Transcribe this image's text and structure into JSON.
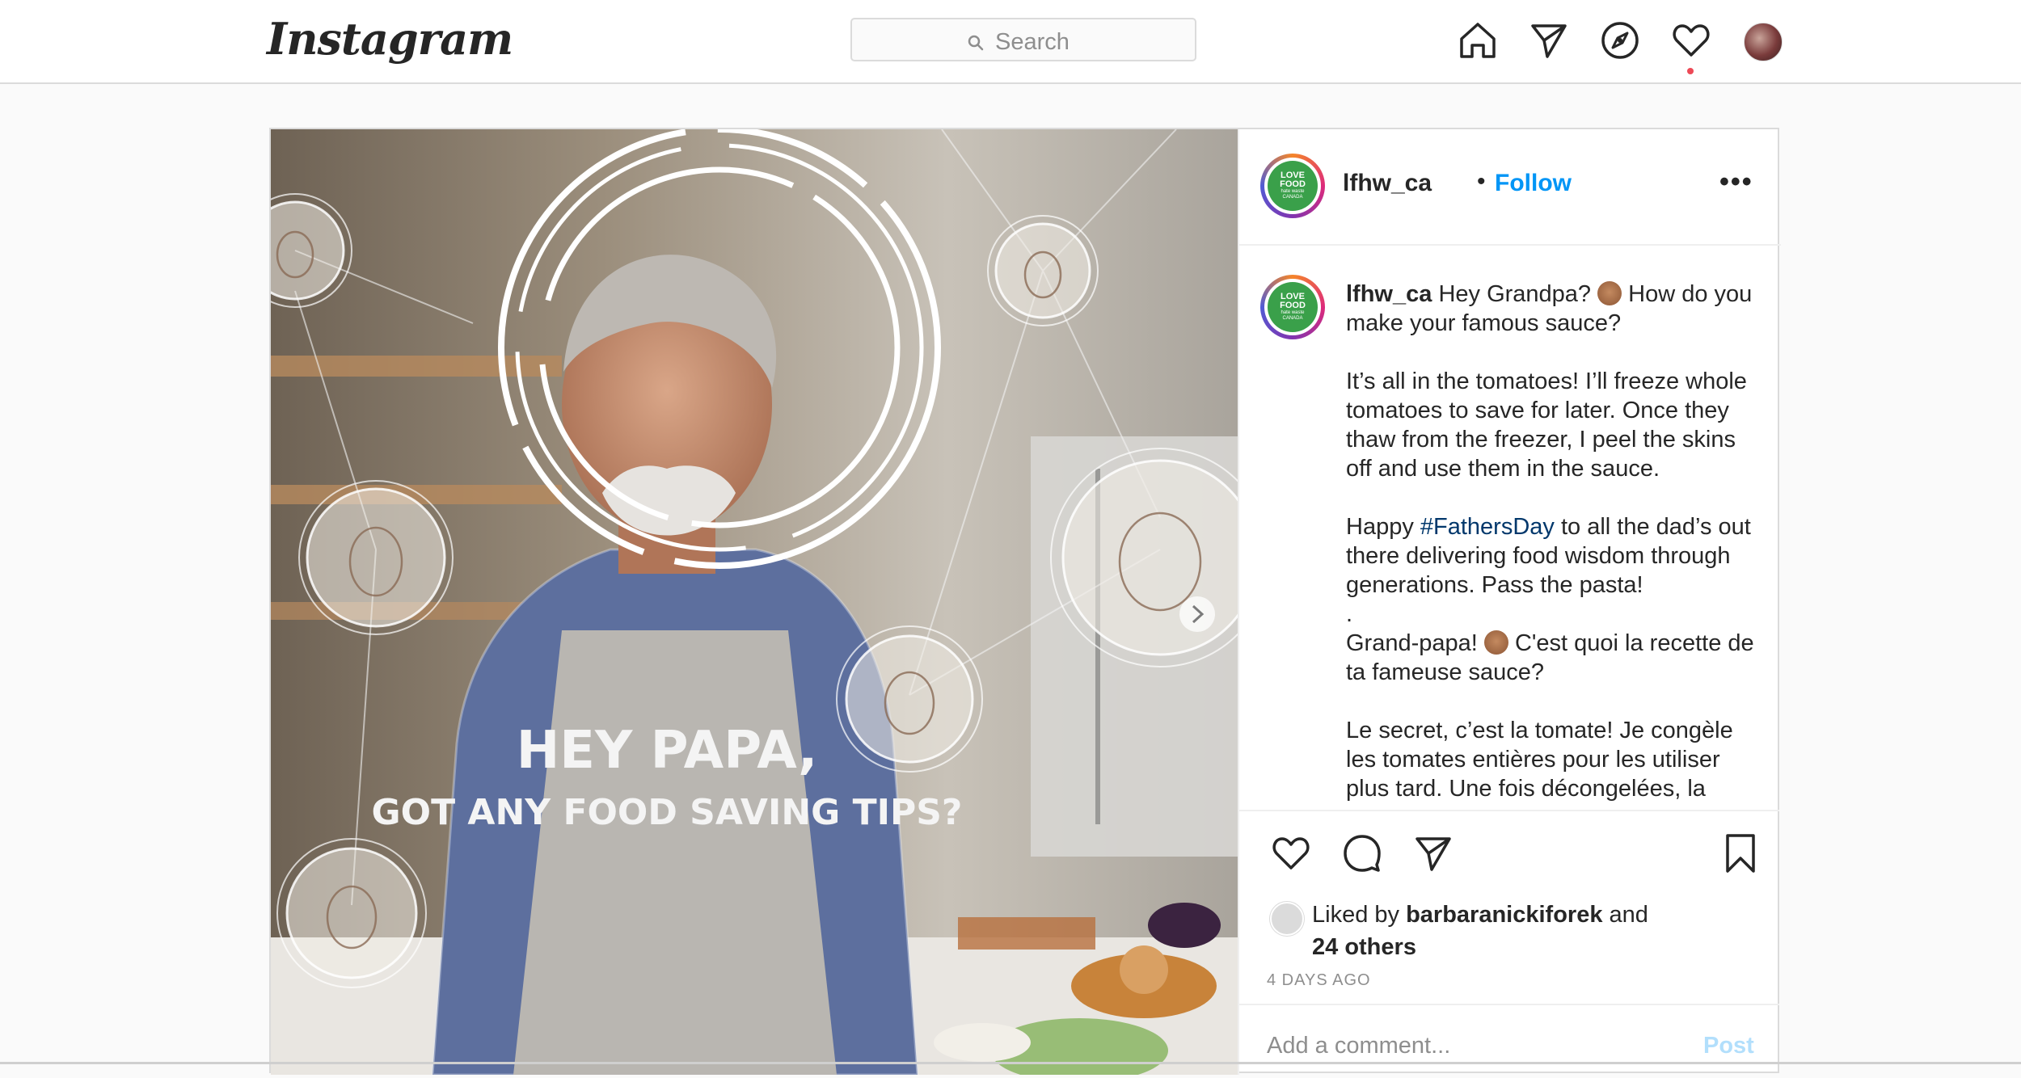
{
  "header": {
    "logo_text": "Instagram",
    "search_placeholder": "Search",
    "nav_icons": [
      "home-icon",
      "direct-icon",
      "explore-icon",
      "activity-icon",
      "profile-avatar"
    ],
    "notification_dot_color": "#ed4956"
  },
  "post": {
    "image_text_line1": "HEY PAPA,",
    "image_text_line2": "GOT ANY FOOD SAVING TIPS?",
    "author": {
      "username": "lfhw_ca",
      "separator": "•",
      "follow_label": "Follow",
      "avatar_text_line1": "LOVE",
      "avatar_text_line2": "FOOD",
      "avatar_text_line3": "hate waste",
      "avatar_text_line4": "CANADA",
      "more_label": "•••"
    },
    "caption": {
      "username": "lfhw_ca",
      "p1_a": "Hey Grandpa? ",
      "p1_b": " How do you make your famous sauce?",
      "p2": "It’s all in the tomatoes! I’ll freeze whole tomatoes to save for later. Once they thaw from the freezer, I peel the skins off and use them in the sauce.",
      "p3_a": "Happy ",
      "p3_tag": "#FathersDay",
      "p3_b": " to all the dad’s out there delivering food wisdom through generations. Pass the pasta!",
      "p3_dot": ".",
      "p4_a": "Grand-papa! ",
      "p4_b": " C'est quoi la recette de ta fameuse sauce?",
      "p5": "Le secret, c’est la tomate! Je congèle les tomates entières pour les utiliser plus tard. Une fois décongelées, la"
    },
    "likes": {
      "prefix": "Liked by ",
      "user": "barbaranickiforek",
      "and": " and",
      "others": "24 others"
    },
    "timestamp": "4 DAYS AGO",
    "comment_placeholder": "Add a comment...",
    "post_label": "Post",
    "colors": {
      "link_blue": "#0095f6",
      "hashtag": "#00376b",
      "brand_green": "#3aa04a"
    }
  }
}
